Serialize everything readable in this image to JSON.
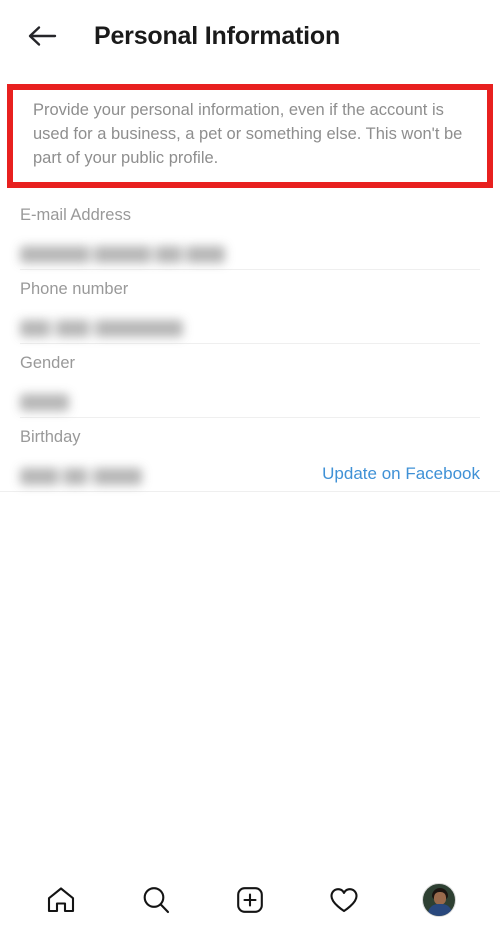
{
  "header": {
    "back_icon": "arrow-left-icon",
    "title": "Personal Information"
  },
  "annotation": {
    "highlight_color": "#e8201f",
    "target": "description-text"
  },
  "description": {
    "text": "Provide your personal information, even if the account is used for a business, a pet or something else. This won't be part of your public profile."
  },
  "fields": [
    {
      "label": "E-mail Address",
      "value": "",
      "value_redacted": true,
      "action": ""
    },
    {
      "label": "Phone number",
      "value": "",
      "value_redacted": true,
      "action": ""
    },
    {
      "label": "Gender",
      "value": "",
      "value_redacted": true,
      "action": ""
    },
    {
      "label": "Birthday",
      "value": "",
      "value_redacted": true,
      "action": "Update on Facebook"
    }
  ],
  "link_color": "#3f91d6",
  "bottom_nav": [
    {
      "icon": "home-icon"
    },
    {
      "icon": "search-icon"
    },
    {
      "icon": "plus-square-icon"
    },
    {
      "icon": "heart-icon"
    },
    {
      "icon": "profile-avatar"
    }
  ]
}
